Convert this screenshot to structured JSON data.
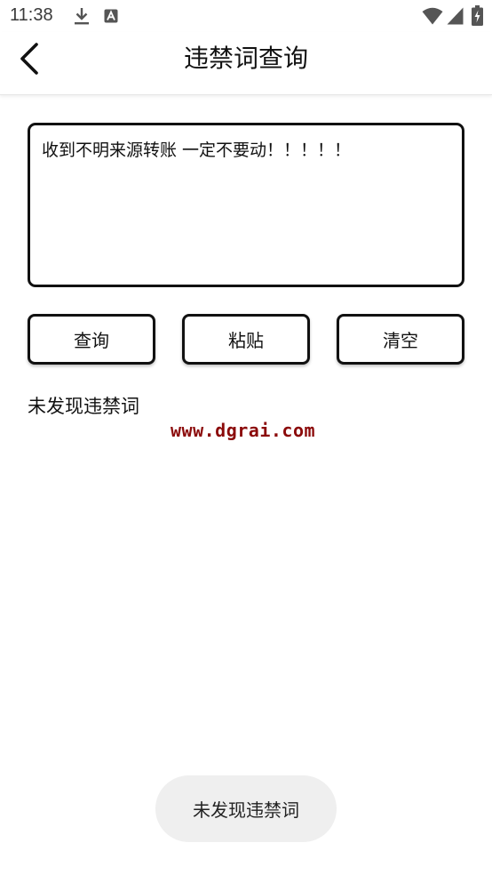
{
  "status_bar": {
    "time": "11:38",
    "icons": [
      "download-icon",
      "a-notification-icon",
      "wifi-icon",
      "signal-icon",
      "battery-charging-icon"
    ]
  },
  "app_bar": {
    "title": "违禁词查询",
    "back_icon": "chevron-left-icon"
  },
  "query": {
    "value": "收到不明来源转账 一定不要动！！！！！",
    "placeholder": ""
  },
  "buttons": {
    "query_label": "查询",
    "paste_label": "粘贴",
    "clear_label": "清空"
  },
  "result": {
    "text": "未发现违禁词"
  },
  "watermark": {
    "text": "www.dgrai.com",
    "color": "#8b0a0a"
  },
  "toast": {
    "text": "未发现违禁词"
  }
}
